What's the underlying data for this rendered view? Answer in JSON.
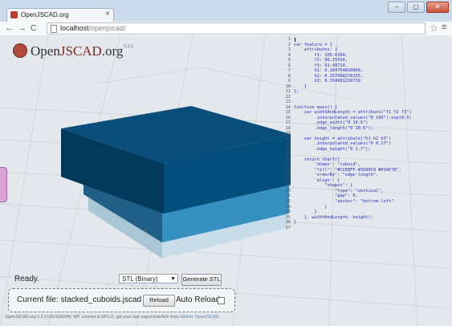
{
  "browser": {
    "tab_title": "OpenJSCAD.org",
    "tab_close": "×",
    "url_host": "localhost",
    "url_path": "/openjscad/",
    "controls": {
      "minimize": "–",
      "maximize": "▢",
      "close": "✕"
    }
  },
  "app": {
    "logo_prefix": "Open",
    "logo_highlight": "JSCAD",
    "logo_suffix": ".org",
    "logo_sup": "0.3.3"
  },
  "editor": {
    "lines": [
      {
        "n": "1",
        "code": ""
      },
      {
        "n": "2",
        "code": "var feature = {"
      },
      {
        "n": "3",
        "code": "    attributes: {"
      },
      {
        "n": "4",
        "code": "        f1: 105.6164,"
      },
      {
        "n": "5",
        "code": "        f2: 96.15534,"
      },
      {
        "n": "6",
        "code": "        f3: 91.49714,"
      },
      {
        "n": "7",
        "code": "        h1: 0.164754810866,"
      },
      {
        "n": "8",
        "code": "        h2: 0.157688278155,"
      },
      {
        "n": "9",
        "code": "        h3: 0.154081259719"
      },
      {
        "n": "10",
        "code": "    }"
      },
      {
        "n": "11",
        "code": "};"
      },
      {
        "n": "12",
        "code": ""
      },
      {
        "n": "13",
        "code": ""
      },
      {
        "n": "14",
        "code": "function main() {"
      },
      {
        "n": "15",
        "code": "    var widthAndLength = attribute(\"f1 f2 f3\")"
      },
      {
        "n": "16",
        "code": "        .interpolated_values(\"0 106\").exp(0.5)"
      },
      {
        "n": "17",
        "code": "        .edge_width(\"0 10.6\")"
      },
      {
        "n": "18",
        "code": "        .edge_length(\"0 10.6\");"
      },
      {
        "n": "19",
        "code": ""
      },
      {
        "n": "20",
        "code": "    var height = attribute(\"h1 h2 h3\")"
      },
      {
        "n": "21",
        "code": "        .interpolated_values(\"0 0.17\")"
      },
      {
        "n": "22",
        "code": "        .edge_height(\"0 1.7\");"
      },
      {
        "n": "23",
        "code": ""
      },
      {
        "n": "24",
        "code": "    return chart({"
      },
      {
        "n": "25",
        "code": "        'shape': \"cuboid\","
      },
      {
        "n": "26",
        "code": "        \"fill\": \"#CCEBFF #3690C0 #034E7B\","
      },
      {
        "n": "27",
        "code": "        'orderBy': \"edge-length\","
      },
      {
        "n": "28",
        "code": "        'align': {"
      },
      {
        "n": "29",
        "code": "            \"shapes\": {"
      },
      {
        "n": "30",
        "code": "                \"type\": \"vertical\","
      },
      {
        "n": "31",
        "code": "                \"gap\": 0,"
      },
      {
        "n": "32",
        "code": "                \"anchor\": \"bottom-left\""
      },
      {
        "n": "33",
        "code": "            }"
      },
      {
        "n": "34",
        "code": "        }"
      },
      {
        "n": "35",
        "code": "    }, widthAndLength, height);"
      },
      {
        "n": "36",
        "code": "}"
      },
      {
        "n": "37",
        "code": ""
      }
    ]
  },
  "status": {
    "ready": "Ready.",
    "format_selected": "STL (Binary)",
    "generate_label": "Generate STL",
    "current_file_label": "Current file: stacked_cuboids.jscad",
    "reload_label": "Reload",
    "auto_reload_label": "Auto Reload"
  },
  "footer": {
    "text": "OpenJSCAD.org 0.3.3 (2015/02/04): MIT License & GPLv2, get your own copy/clone/fork from ",
    "link": "GitHub: OpenJSCAD"
  },
  "colors": {
    "fill_top": "#034E7B",
    "fill_mid": "#3690C0",
    "fill_bottom": "#CCEBFF",
    "grid": "#c8cdd3"
  }
}
